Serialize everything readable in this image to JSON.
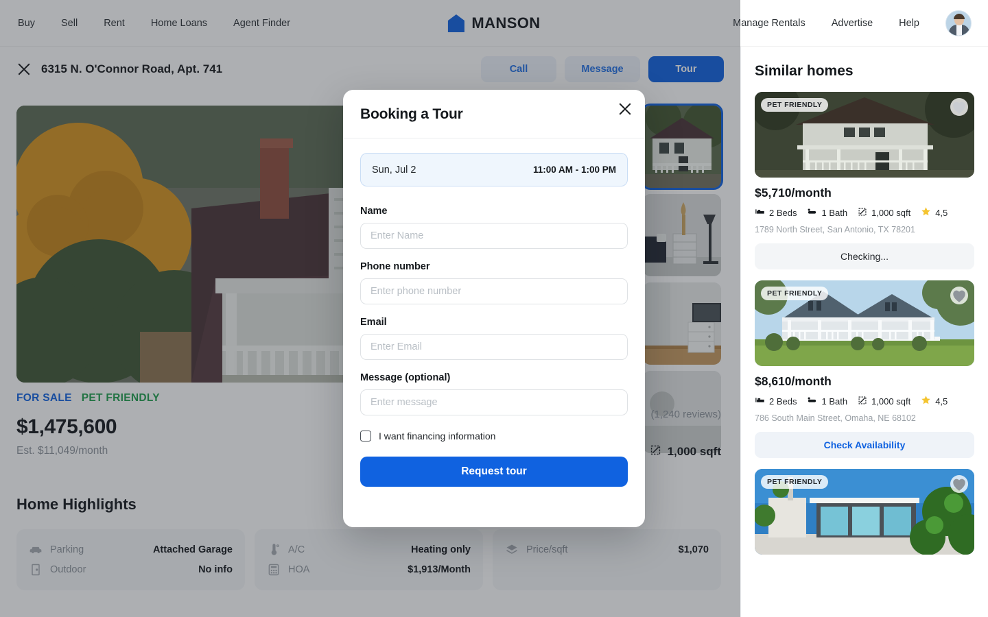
{
  "nav": {
    "left_links": [
      "Buy",
      "Sell",
      "Rent",
      "Home Loans",
      "Agent Finder"
    ],
    "right_links": [
      "Manage Rentals",
      "Advertise",
      "Help"
    ],
    "brand": "MANSON",
    "brand_color": "#1062e0"
  },
  "property_bar": {
    "address": "6315 N. O'Connor Road, Apt. 741",
    "buttons": {
      "call": "Call",
      "message": "Message",
      "tour": "Tour"
    }
  },
  "listing": {
    "tag_sale": "FOR SALE",
    "tag_pet": "PET FRIENDLY",
    "price": "$1,475,600",
    "est": "Est. $11,049/month",
    "reviews": "(1,240 reviews)",
    "sqft": "1,000 sqft"
  },
  "highlights": {
    "title": "Home Highlights",
    "cards": [
      {
        "rows": [
          {
            "icon": "car-icon",
            "key": "Parking",
            "value": "Attached Garage"
          },
          {
            "icon": "door-icon",
            "key": "Outdoor",
            "value": "No info"
          }
        ]
      },
      {
        "rows": [
          {
            "icon": "thermometer-icon",
            "key": "A/C",
            "value": "Heating only"
          },
          {
            "icon": "calculator-icon",
            "key": "HOA",
            "value": "$1,913/Month"
          }
        ]
      },
      {
        "rows": [
          {
            "icon": "layers-icon",
            "key": "Price/sqft",
            "value": "$1,070"
          }
        ]
      }
    ]
  },
  "sidebar": {
    "title": "Similar homes",
    "cards": [
      {
        "badge": "PET FRIENDLY",
        "price": "$5,710/month",
        "beds": "2 Beds",
        "baths": "1 Bath",
        "sqft": "1,000 sqft",
        "rating": "4,5",
        "address": "1789 North Street, San Antonio, TX 78201",
        "action": "Checking...",
        "action_style": "checking"
      },
      {
        "badge": "PET FRIENDLY",
        "price": "$8,610/month",
        "beds": "2 Beds",
        "baths": "1 Bath",
        "sqft": "1,000 sqft",
        "rating": "4,5",
        "address": "786 South Main Street, Omaha, NE 68102",
        "action": "Check Availability",
        "action_style": "avail"
      },
      {
        "badge": "PET FRIENDLY",
        "price": "",
        "beds": "",
        "baths": "",
        "sqft": "",
        "rating": "",
        "address": "",
        "action": "",
        "action_style": ""
      }
    ]
  },
  "modal": {
    "title": "Booking a Tour",
    "slot_date": "Sun, Jul 2",
    "slot_time": "11:00 AM - 1:00 PM",
    "fields": [
      {
        "label": "Name",
        "placeholder": "Enter Name",
        "value": ""
      },
      {
        "label": "Phone number",
        "placeholder": "Enter phone number",
        "value": ""
      },
      {
        "label": "Email",
        "placeholder": "Enter Email",
        "value": ""
      },
      {
        "label": "Message (optional)",
        "placeholder": "Enter message",
        "value": ""
      }
    ],
    "checkbox_label": "I want financing information",
    "submit_label": "Request tour",
    "accent_color": "#1062e0"
  }
}
